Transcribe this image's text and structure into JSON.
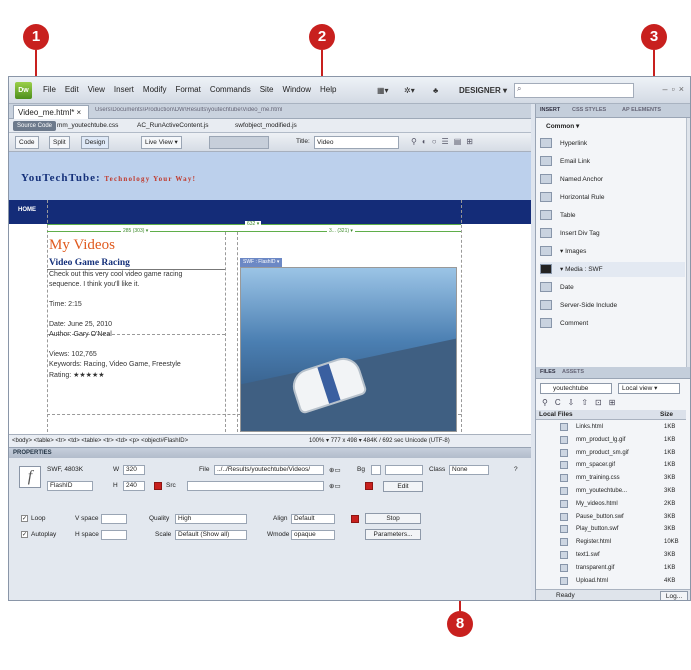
{
  "callouts": [
    "1",
    "2",
    "3",
    "8"
  ],
  "menu": {
    "logo": "Dw",
    "items": [
      "File",
      "Edit",
      "View",
      "Insert",
      "Modify",
      "Format",
      "Commands",
      "Site",
      "Window",
      "Help"
    ],
    "designer": "DESIGNER ▾"
  },
  "doc": {
    "tab_label": "Video_me.html* ×",
    "path": "Users\\Documents\\Production\\DW\\Results\\youtechtube\\Video_me.html",
    "source_code": "Source Code",
    "related_files": [
      "mm_youtechtube.css",
      "AC_RunActiveContent.js",
      "swfobject_modified.js"
    ],
    "toolbar": {
      "code": "Code",
      "split": "Split",
      "design": "Design",
      "live_view": "Live View ▾",
      "title_label": "Title:",
      "title_value": "Video"
    }
  },
  "page": {
    "site_title": "YouTechTube:",
    "tagline": "Technology Your Way!",
    "nav_home": "HOME",
    "width_top": "632 ▾",
    "width_left": "285 (303) ▾",
    "width_right": "3... (321) ▾",
    "heading": "My Videos",
    "article_title": "Video Game Racing",
    "article_lines": [
      "Check out this very cool video game racing",
      "sequence. I think you'll like it.",
      "",
      "Time: 2:15",
      "",
      "Date: June 25, 2010",
      "Author: Gary O'Neal",
      "",
      "Views: 102,765",
      "Keywords: Racing, Video Game, Freestyle",
      "Rating: ★★★★★"
    ],
    "swf_tag": "SWF : FlashID ▾"
  },
  "status": {
    "tags": "<body> <table> <tr> <td> <table> <tr> <td> <p> <object#FlashID>",
    "right": "100% ▾  777 x 498 ▾  484K / 692 sec  Unicode (UTF-8)"
  },
  "properties": {
    "title": "PROPERTIES",
    "swf_label": "SWF, 4803K",
    "w_label": "W",
    "w_value": "320",
    "h_label": "H",
    "h_value": "240",
    "id_value": "FlashID",
    "file_label": "File",
    "file_value": "../../Results/youtechtube/Videos/",
    "src_label": "Src",
    "bg_label": "Bg",
    "class_label": "Class",
    "class_value": "None",
    "edit_label": "Edit",
    "loop_label": "Loop",
    "autoplay_label": "Autoplay",
    "vspace_label": "V space",
    "hspace_label": "H space",
    "quality_label": "Quality",
    "quality_value": "High",
    "scale_label": "Scale",
    "scale_value": "Default (Show all)",
    "align_label": "Align",
    "align_value": "Default",
    "wmode_label": "Wmode",
    "wmode_value": "opaque",
    "stop_label": "Stop",
    "params_label": "Parameters..."
  },
  "insert_panel": {
    "tabs": [
      "INSERT",
      "CSS STYLES",
      "AP ELEMENTS"
    ],
    "category": "Common ▾",
    "items": [
      "Hyperlink",
      "Email Link",
      "Named Anchor",
      "Horizontal Rule",
      "Table",
      "Insert Div Tag",
      "▾ Images",
      "▾ Media : SWF",
      "Date",
      "Server-Side Include",
      "Comment"
    ]
  },
  "files_panel": {
    "tabs": [
      "FILES",
      "ASSETS"
    ],
    "site": "youtechtube",
    "view": "Local view ▾",
    "header_name": "Local Files",
    "header_size": "Size",
    "files": [
      {
        "name": "Links.html",
        "size": "1KB"
      },
      {
        "name": "mm_product_lg.gif",
        "size": "1KB"
      },
      {
        "name": "mm_product_sm.gif",
        "size": "1KB"
      },
      {
        "name": "mm_spacer.gif",
        "size": "1KB"
      },
      {
        "name": "mm_training.css",
        "size": "3KB"
      },
      {
        "name": "mm_youtechtube...",
        "size": "3KB"
      },
      {
        "name": "My_videos.html",
        "size": "2KB"
      },
      {
        "name": "Pause_button.swf",
        "size": "3KB"
      },
      {
        "name": "Play_button.swf",
        "size": "3KB"
      },
      {
        "name": "Register.html",
        "size": "10KB"
      },
      {
        "name": "text1.swf",
        "size": "3KB"
      },
      {
        "name": "transparent.gif",
        "size": "1KB"
      },
      {
        "name": "Upload.html",
        "size": "4KB"
      }
    ],
    "status": "Ready",
    "log": "Log..."
  }
}
